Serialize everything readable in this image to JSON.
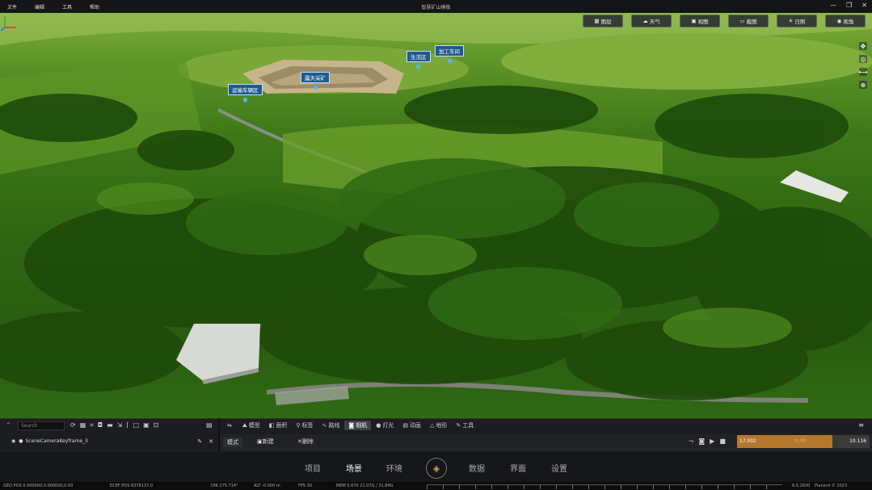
{
  "menubar": {
    "items": [
      "文件",
      "编辑",
      "工具",
      "帮助"
    ],
    "title": "智慧矿山模板"
  },
  "viewport": {
    "top_buttons": [
      {
        "icon": "grid-icon",
        "glyph": "▦",
        "label": "图层"
      },
      {
        "icon": "weather-icon",
        "glyph": "☁",
        "label": "天气"
      },
      {
        "icon": "view-icon",
        "glyph": "▣",
        "label": "视图"
      },
      {
        "icon": "screenshot-icon",
        "glyph": "▭",
        "label": "截图"
      },
      {
        "icon": "sun-icon",
        "glyph": "☀",
        "label": "日照"
      },
      {
        "icon": "eye-icon",
        "glyph": "◉",
        "label": "视角"
      }
    ],
    "side_tools": [
      "move-icon",
      "globe-icon",
      "measure-icon",
      "compass-icon"
    ],
    "markers": [
      {
        "label": "运输车辆区"
      },
      {
        "label": "露天采矿"
      },
      {
        "label": "生活区"
      },
      {
        "label": "加工车间"
      }
    ]
  },
  "left_panel": {
    "search_placeholder": "Search",
    "layer_name": "SceneCameraKeyframe_3"
  },
  "right_panel": {
    "tabs": [
      {
        "glyph": "⇋",
        "label": ""
      },
      {
        "glyph": "⛰",
        "label": "模型"
      },
      {
        "glyph": "◧",
        "label": "面积"
      },
      {
        "glyph": "⚲",
        "label": "标签"
      },
      {
        "glyph": "∿",
        "label": "路线"
      },
      {
        "glyph": "◙",
        "label": "相机"
      },
      {
        "glyph": "●",
        "label": "灯光"
      },
      {
        "glyph": "▤",
        "label": "动画"
      },
      {
        "glyph": "△",
        "label": "地形"
      },
      {
        "glyph": "✎",
        "label": "工具"
      }
    ],
    "active_tab": 5,
    "mode_label": "模式",
    "new_label": "新建",
    "delete_label": "删除",
    "timeline": {
      "start": "17.002",
      "mid": "0.00",
      "end": "10.116",
      "progress": 0.72
    }
  },
  "bottom_nav": {
    "items": [
      "项目",
      "场景",
      "环境",
      "数据",
      "界面",
      "设置"
    ],
    "active": "场景"
  },
  "status": {
    "geo": "GEO POS 0.000000,0.000000,0.00",
    "ecef": "ECEF POS 6378137.0",
    "dir": "DIR 175.714°",
    "alt": "ALT -0.000 m",
    "fps": "FPS 30",
    "mem": "MEM 5.670 21.07G / 31.84G",
    "version": "6.5.2830",
    "copyright": "Placenil © 2023"
  },
  "colors": {
    "accent": "#b5782e",
    "marker": "#1f5a8f",
    "marker_pin": "#4db8ff"
  }
}
